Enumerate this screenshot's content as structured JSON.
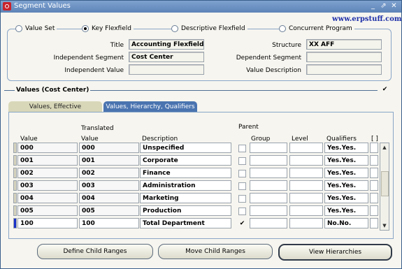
{
  "window": {
    "title": "Segment Values",
    "watermark": "www.erpstuff.com"
  },
  "source_radios": [
    {
      "label": "Value Set",
      "selected": false
    },
    {
      "label": "Key Flexfield",
      "selected": true
    },
    {
      "label": "Descriptive Flexfield",
      "selected": false
    },
    {
      "label": "Concurrent Program",
      "selected": false
    }
  ],
  "header": {
    "title_label": "Title",
    "title_value": "Accounting Flexfield",
    "structure_label": "Structure",
    "structure_value": "XX AFF",
    "indep_segment_label": "Independent Segment",
    "indep_segment_value": "Cost Center",
    "dep_segment_label": "Dependent Segment",
    "dep_segment_value": "",
    "indep_value_label": "Independent Value",
    "indep_value_value": "",
    "value_desc_label": "Value Description",
    "value_desc_value": ""
  },
  "values_section": {
    "title": "Values (Cost Center)",
    "tabs": [
      {
        "label": "Values, Effective",
        "active": false
      },
      {
        "label": "Values, Hierarchy, Qualifiers",
        "active": true
      }
    ],
    "columns": {
      "value": "Value",
      "translated_top": "Translated",
      "translated_bottom": "Value",
      "description": "Description",
      "parent": "Parent",
      "group": "Group",
      "level": "Level",
      "qualifiers": "Qualifiers",
      "flex": "[ ]"
    },
    "rows": [
      {
        "value": "000",
        "translated": "000",
        "description": "Unspecified",
        "parent": false,
        "group": "",
        "level": "",
        "qualifiers": "Yes.Yes."
      },
      {
        "value": "001",
        "translated": "001",
        "description": "Corporate",
        "parent": false,
        "group": "",
        "level": "",
        "qualifiers": "Yes.Yes."
      },
      {
        "value": "002",
        "translated": "002",
        "description": "Finance",
        "parent": false,
        "group": "",
        "level": "",
        "qualifiers": "Yes.Yes."
      },
      {
        "value": "003",
        "translated": "003",
        "description": "Administration",
        "parent": false,
        "group": "",
        "level": "",
        "qualifiers": "Yes.Yes."
      },
      {
        "value": "004",
        "translated": "004",
        "description": "Marketing",
        "parent": false,
        "group": "",
        "level": "",
        "qualifiers": "Yes.Yes."
      },
      {
        "value": "005",
        "translated": "005",
        "description": "Production",
        "parent": false,
        "group": "",
        "level": "",
        "qualifiers": "Yes.Yes."
      },
      {
        "value": "100",
        "translated": "100",
        "description": "Total Department",
        "parent": true,
        "group": "",
        "level": "",
        "qualifiers": "No.No."
      }
    ]
  },
  "buttons": {
    "define_child": "Define Child Ranges",
    "move_child": "Move Child Ranges",
    "view_hierarchies": "View Hierarchies"
  },
  "colors": {
    "titlebar": "#5d84b8",
    "active_tab": "#4a74b0",
    "current_row": "#1c33c9",
    "watermark": "#1e2fa8"
  }
}
